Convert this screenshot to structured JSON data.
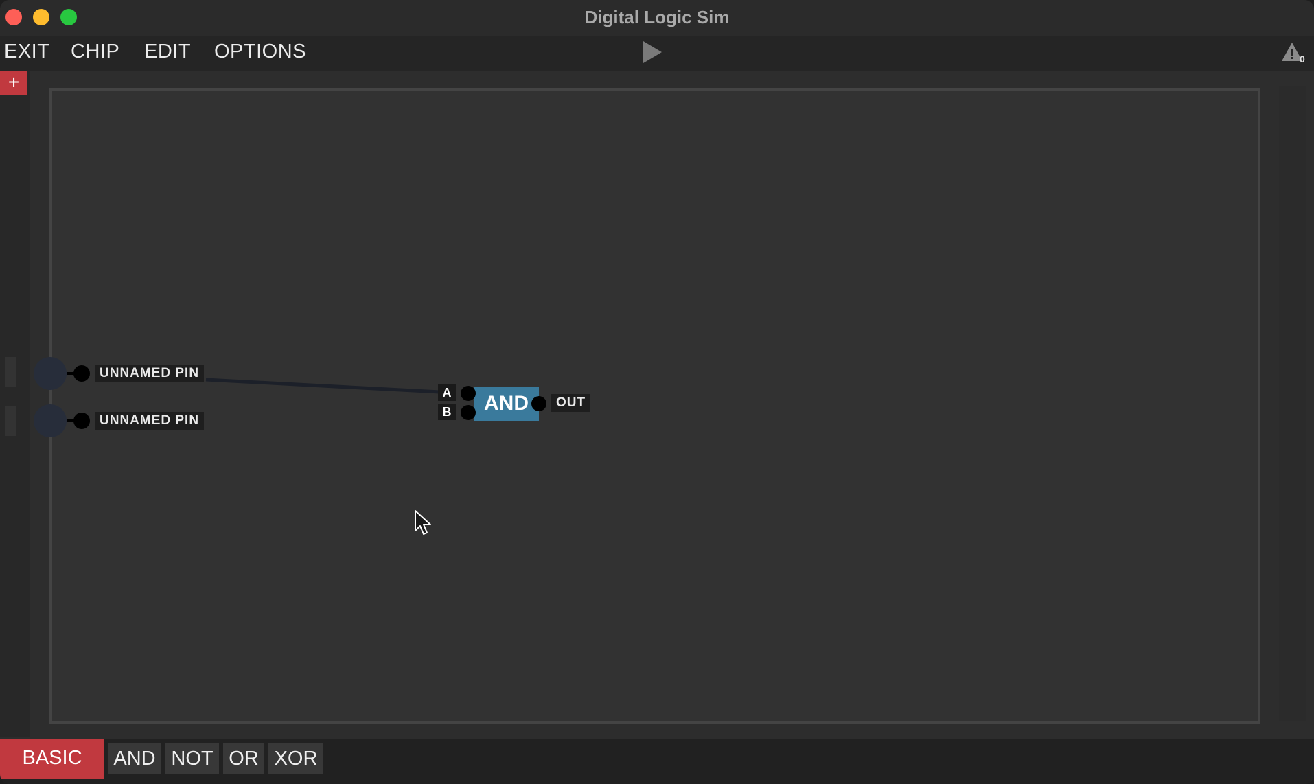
{
  "window": {
    "title": "Digital Logic Sim"
  },
  "menu": {
    "exit": "EXIT",
    "chip": "CHIP",
    "edit": "EDIT",
    "options": "OPTIONS",
    "play_icon": "play-icon",
    "warning_icon": "warning-triangle-icon",
    "warning_count": "0"
  },
  "left_panel": {
    "add_button": "+"
  },
  "canvas": {
    "input_pins": [
      {
        "label": "UNNAMED PIN"
      },
      {
        "label": "UNNAMED PIN"
      }
    ],
    "chip": {
      "name": "AND",
      "inputs": [
        "A",
        "B"
      ],
      "output": "OUT",
      "color": "#3a7a9c"
    }
  },
  "bottom_bar": {
    "category": "BASIC",
    "chips": [
      "AND",
      "NOT",
      "OR",
      "XOR"
    ]
  },
  "colors": {
    "accent": "#c1393f",
    "background": "#323232",
    "chip": "#3a7a9c"
  }
}
